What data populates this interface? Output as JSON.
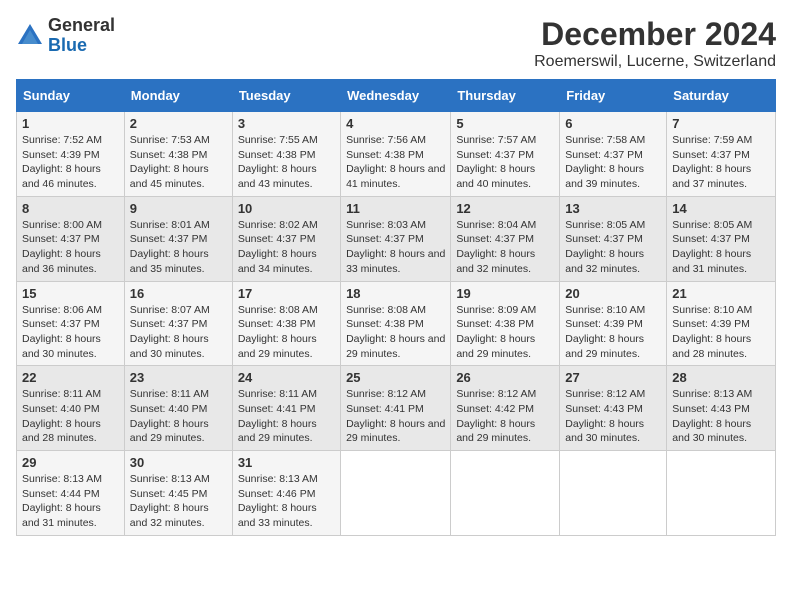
{
  "header": {
    "logo_general": "General",
    "logo_blue": "Blue",
    "month_title": "December 2024",
    "location": "Roemerswil, Lucerne, Switzerland"
  },
  "days_of_week": [
    "Sunday",
    "Monday",
    "Tuesday",
    "Wednesday",
    "Thursday",
    "Friday",
    "Saturday"
  ],
  "weeks": [
    [
      {
        "day": "1",
        "sunrise": "7:52 AM",
        "sunset": "4:39 PM",
        "daylight": "8 hours and 46 minutes."
      },
      {
        "day": "2",
        "sunrise": "7:53 AM",
        "sunset": "4:38 PM",
        "daylight": "8 hours and 45 minutes."
      },
      {
        "day": "3",
        "sunrise": "7:55 AM",
        "sunset": "4:38 PM",
        "daylight": "8 hours and 43 minutes."
      },
      {
        "day": "4",
        "sunrise": "7:56 AM",
        "sunset": "4:38 PM",
        "daylight": "8 hours and 41 minutes."
      },
      {
        "day": "5",
        "sunrise": "7:57 AM",
        "sunset": "4:37 PM",
        "daylight": "8 hours and 40 minutes."
      },
      {
        "day": "6",
        "sunrise": "7:58 AM",
        "sunset": "4:37 PM",
        "daylight": "8 hours and 39 minutes."
      },
      {
        "day": "7",
        "sunrise": "7:59 AM",
        "sunset": "4:37 PM",
        "daylight": "8 hours and 37 minutes."
      }
    ],
    [
      {
        "day": "8",
        "sunrise": "8:00 AM",
        "sunset": "4:37 PM",
        "daylight": "8 hours and 36 minutes."
      },
      {
        "day": "9",
        "sunrise": "8:01 AM",
        "sunset": "4:37 PM",
        "daylight": "8 hours and 35 minutes."
      },
      {
        "day": "10",
        "sunrise": "8:02 AM",
        "sunset": "4:37 PM",
        "daylight": "8 hours and 34 minutes."
      },
      {
        "day": "11",
        "sunrise": "8:03 AM",
        "sunset": "4:37 PM",
        "daylight": "8 hours and 33 minutes."
      },
      {
        "day": "12",
        "sunrise": "8:04 AM",
        "sunset": "4:37 PM",
        "daylight": "8 hours and 32 minutes."
      },
      {
        "day": "13",
        "sunrise": "8:05 AM",
        "sunset": "4:37 PM",
        "daylight": "8 hours and 32 minutes."
      },
      {
        "day": "14",
        "sunrise": "8:05 AM",
        "sunset": "4:37 PM",
        "daylight": "8 hours and 31 minutes."
      }
    ],
    [
      {
        "day": "15",
        "sunrise": "8:06 AM",
        "sunset": "4:37 PM",
        "daylight": "8 hours and 30 minutes."
      },
      {
        "day": "16",
        "sunrise": "8:07 AM",
        "sunset": "4:37 PM",
        "daylight": "8 hours and 30 minutes."
      },
      {
        "day": "17",
        "sunrise": "8:08 AM",
        "sunset": "4:38 PM",
        "daylight": "8 hours and 29 minutes."
      },
      {
        "day": "18",
        "sunrise": "8:08 AM",
        "sunset": "4:38 PM",
        "daylight": "8 hours and 29 minutes."
      },
      {
        "day": "19",
        "sunrise": "8:09 AM",
        "sunset": "4:38 PM",
        "daylight": "8 hours and 29 minutes."
      },
      {
        "day": "20",
        "sunrise": "8:10 AM",
        "sunset": "4:39 PM",
        "daylight": "8 hours and 29 minutes."
      },
      {
        "day": "21",
        "sunrise": "8:10 AM",
        "sunset": "4:39 PM",
        "daylight": "8 hours and 28 minutes."
      }
    ],
    [
      {
        "day": "22",
        "sunrise": "8:11 AM",
        "sunset": "4:40 PM",
        "daylight": "8 hours and 28 minutes."
      },
      {
        "day": "23",
        "sunrise": "8:11 AM",
        "sunset": "4:40 PM",
        "daylight": "8 hours and 29 minutes."
      },
      {
        "day": "24",
        "sunrise": "8:11 AM",
        "sunset": "4:41 PM",
        "daylight": "8 hours and 29 minutes."
      },
      {
        "day": "25",
        "sunrise": "8:12 AM",
        "sunset": "4:41 PM",
        "daylight": "8 hours and 29 minutes."
      },
      {
        "day": "26",
        "sunrise": "8:12 AM",
        "sunset": "4:42 PM",
        "daylight": "8 hours and 29 minutes."
      },
      {
        "day": "27",
        "sunrise": "8:12 AM",
        "sunset": "4:43 PM",
        "daylight": "8 hours and 30 minutes."
      },
      {
        "day": "28",
        "sunrise": "8:13 AM",
        "sunset": "4:43 PM",
        "daylight": "8 hours and 30 minutes."
      }
    ],
    [
      {
        "day": "29",
        "sunrise": "8:13 AM",
        "sunset": "4:44 PM",
        "daylight": "8 hours and 31 minutes."
      },
      {
        "day": "30",
        "sunrise": "8:13 AM",
        "sunset": "4:45 PM",
        "daylight": "8 hours and 32 minutes."
      },
      {
        "day": "31",
        "sunrise": "8:13 AM",
        "sunset": "4:46 PM",
        "daylight": "8 hours and 33 minutes."
      },
      null,
      null,
      null,
      null
    ]
  ],
  "labels": {
    "sunrise": "Sunrise: ",
    "sunset": "Sunset: ",
    "daylight": "Daylight: "
  }
}
